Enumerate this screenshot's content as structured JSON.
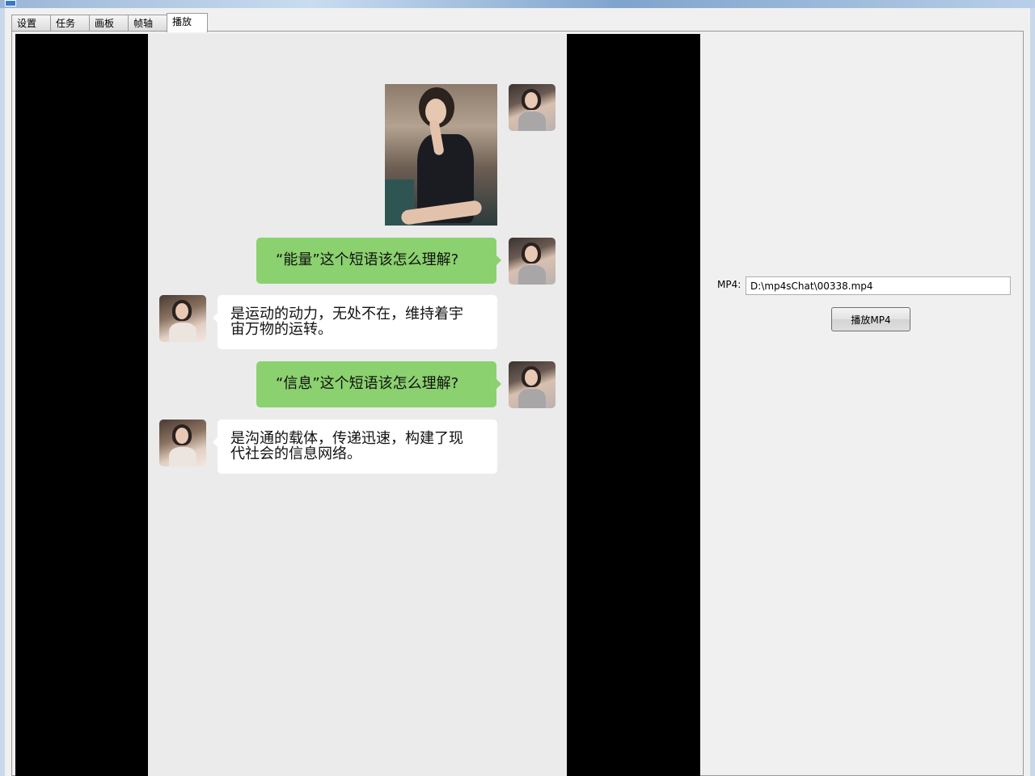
{
  "window": {
    "tabs": [
      {
        "label": "设置"
      },
      {
        "label": "任务"
      },
      {
        "label": "画板"
      },
      {
        "label": "帧轴"
      },
      {
        "label": "播放"
      }
    ],
    "active_tab": "播放"
  },
  "chat": {
    "messages": [
      {
        "from": "me",
        "type": "image",
        "content": "photo"
      },
      {
        "from": "me",
        "type": "text",
        "lines": [
          "“能量”这个短语该怎么理解?"
        ]
      },
      {
        "from": "other",
        "type": "text",
        "lines": [
          "是运动的动力，无处不在，维持着宇",
          "宙万物的运转。"
        ]
      },
      {
        "from": "me",
        "type": "text",
        "lines": [
          "“信息”这个短语该怎么理解?"
        ]
      },
      {
        "from": "other",
        "type": "text",
        "lines": [
          "是沟通的载体，传递迅速，构建了现",
          "代社会的信息网络。"
        ]
      }
    ]
  },
  "player": {
    "mp4_label": "MP4:",
    "mp4_path": "D:\\mp4sChat\\00338.mp4",
    "play_button_label": "播放MP4"
  },
  "colors": {
    "my_bubble": "#8bd16f",
    "other_bubble": "#ffffff",
    "chat_background": "#ebebeb",
    "letterbox": "#000000"
  }
}
